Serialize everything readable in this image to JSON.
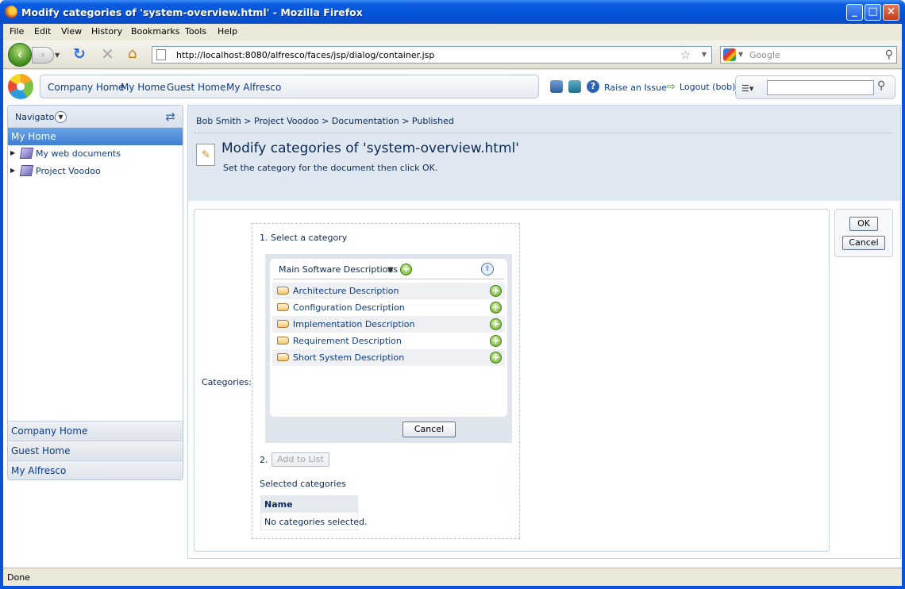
{
  "window": {
    "title": "Modify categories of 'system-overview.html' - Mozilla Firefox",
    "minimize_glyph": "_",
    "maximize_glyph": "□",
    "close_glyph": "×"
  },
  "menu": [
    "File",
    "Edit",
    "View",
    "History",
    "Bookmarks",
    "Tools",
    "Help"
  ],
  "toolbar": {
    "url": "http://localhost:8080/alfresco/faces/jsp/dialog/container.jsp",
    "search_placeholder": "Google"
  },
  "header": {
    "links": [
      "Company Home",
      "My Home",
      "Guest Home",
      "My Alfresco"
    ],
    "raise_issue": "Raise an Issue",
    "logout": "Logout (bob)"
  },
  "navigator": {
    "title": "Navigator",
    "selected": "My Home",
    "tree": [
      "My web documents",
      "Project Voodoo"
    ],
    "bottom": [
      "Company Home",
      "Guest Home",
      "My Alfresco"
    ]
  },
  "breadcrumb": "Bob Smith > Project Voodoo > Documentation > Published",
  "dialog": {
    "title": "Modify categories of 'system-overview.html'",
    "subtitle": "Set the category for the document then click OK.",
    "ok": "OK",
    "cancel": "Cancel",
    "categories_label": "Categories:",
    "step1": "1. Select a category",
    "picker_title": "Main Software Descriptions",
    "items": [
      "Architecture Description",
      "Configuration Description",
      "Implementation Description",
      "Requirement Description",
      "Short System Description"
    ],
    "picker_cancel": "Cancel",
    "step2": "2.",
    "add_to_list": "Add to List",
    "selected_label": "Selected categories",
    "table_header": "Name",
    "empty_text": "No categories selected."
  },
  "status": "Done"
}
